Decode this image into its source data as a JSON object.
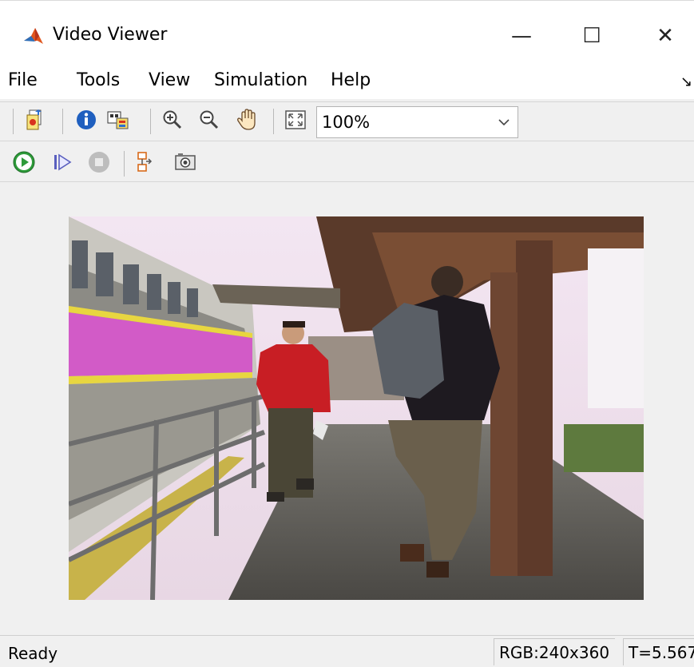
{
  "window": {
    "title": "Video Viewer",
    "controls": {
      "minimize": "—",
      "maximize": "☐",
      "close": "✕"
    }
  },
  "menu": {
    "items": [
      "File",
      "Tools",
      "View",
      "Simulation",
      "Help"
    ],
    "overflow_arrow": "↘"
  },
  "toolbar": {
    "zoom_value": "100%",
    "icons": [
      "open-icon",
      "info-icon",
      "pixel-info-icon",
      "zoom-in-icon",
      "zoom-out-icon",
      "pan-hand-icon",
      "fit-to-window-icon"
    ]
  },
  "playback": {
    "icons": [
      "play-icon",
      "step-forward-icon",
      "stop-icon",
      "highlight-block-icon",
      "snapshot-icon"
    ]
  },
  "status": {
    "ready": "Ready",
    "rgb": "RGB:240x360",
    "time": "T=5.567"
  },
  "colors": {
    "chrome_bg": "#f0f0f0",
    "play_green": "#2e9b3a",
    "info_blue": "#1f5fbf",
    "train_stripe": "#d25bc7"
  }
}
